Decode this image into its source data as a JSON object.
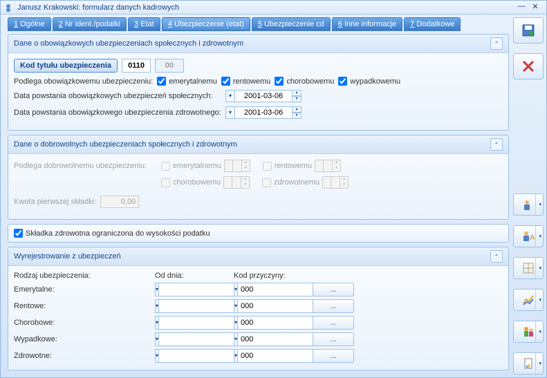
{
  "window": {
    "title": "Janusz Krakowski: formularz danych kadrowych"
  },
  "tabs": [
    {
      "label": "1 Ogólne",
      "accel": "1"
    },
    {
      "label": "2 Nr ident./podatki",
      "accel": "2"
    },
    {
      "label": "3 Etat",
      "accel": "3"
    },
    {
      "label": "4 Ubezpieczenie (etat)",
      "accel": "4",
      "active": true
    },
    {
      "label": "5 Ubezpieczenie cd",
      "accel": "5"
    },
    {
      "label": "6 Inne informacje",
      "accel": "6"
    },
    {
      "label": "7 Dodatkowe",
      "accel": "7"
    }
  ],
  "panel1": {
    "title": "Dane o obowiązkowych ubezpieczeniach społecznych i zdrowotnym",
    "code_btn": "Kod tytułu ubezpieczenia",
    "code1": "0110",
    "code2": "00",
    "mandatory_label": "Podlega obowiązkowemu ubezpieczeniu:",
    "opts": {
      "emerytalnemu": "emerytalnemu",
      "rentowemu": "rentowemu",
      "chorobowemu": "chorobowemu",
      "wypadkowemu": "wypadkowemu"
    },
    "date1_label": "Data powstania obowiązkowych ubezpieczeń społecznych:",
    "date1": "2001-03-06",
    "date2_label": "Data powstania obowiązkowego ubezpieczenia zdrowotnego:",
    "date2": "2001-03-06"
  },
  "panel2": {
    "title": "Dane o dobrowolnych ubezpieczeniach społecznych i zdrowotnym",
    "voluntary_label": "Podlega dobrowolnemu ubezpieczeniu:",
    "opts": {
      "emerytalnemu": "emerytalnemu",
      "rentowemu": "rentowemu",
      "chorobowemu": "chorobowemu",
      "zdrowotnemu": "zdrowotnemu"
    },
    "kwota_label": "Kwota pierwszej składki:",
    "kwota": "0,00"
  },
  "panel3": {
    "check_label": "Składka zdrowotna ograniczona do wysokości podatku"
  },
  "panel4": {
    "title": "Wyrejestrowanie z ubezpieczeń",
    "col_type": "Rodzaj ubezpieczenia:",
    "col_date": "Od dnia:",
    "col_code": "Kod przyczyny:",
    "rows": [
      {
        "label": "Emerytalne:",
        "date": "",
        "code": "000"
      },
      {
        "label": "Rentowe:",
        "date": "",
        "code": "000"
      },
      {
        "label": "Chorobowe:",
        "date": "",
        "code": "000"
      },
      {
        "label": "Wypadkowe:",
        "date": "",
        "code": "000"
      },
      {
        "label": "Zdrowotne:",
        "date": "",
        "code": "000"
      }
    ],
    "dots": "..."
  }
}
